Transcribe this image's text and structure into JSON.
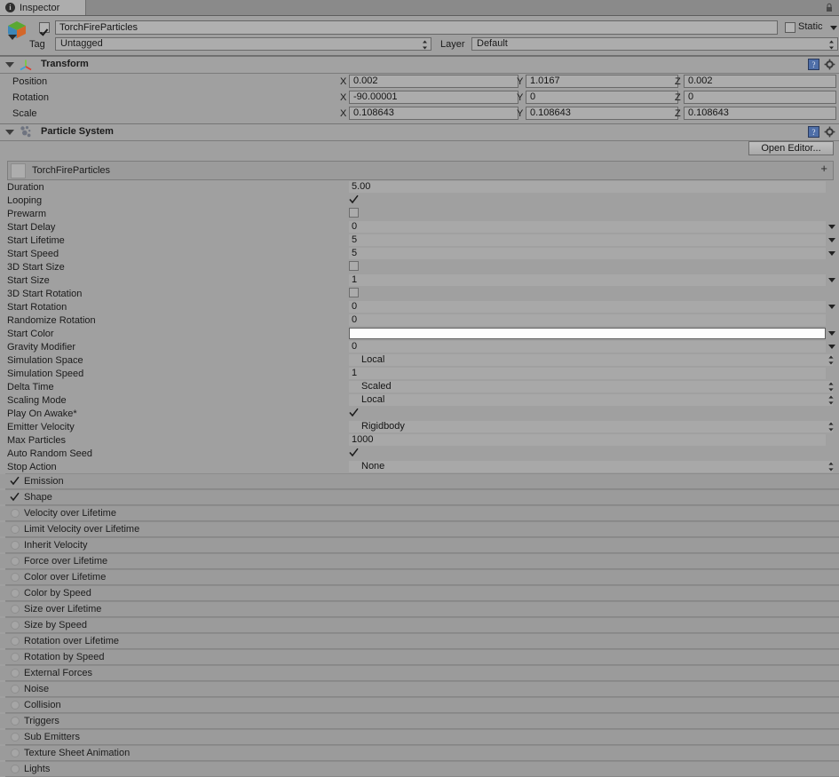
{
  "window": {
    "tab_label": "Inspector",
    "tab_icon": "info-icon",
    "lock_icon": "lock-icon"
  },
  "gameobject": {
    "icon": "gameobject-cube-icon",
    "enabled": true,
    "name": "TorchFireParticles",
    "name_placeholder": "Name",
    "static_label": "Static",
    "static_checked": false,
    "tag_label": "Tag",
    "tag_value": "Untagged",
    "layer_label": "Layer",
    "layer_value": "Default"
  },
  "transform": {
    "title": "Transform",
    "icon": "transform-axis-icon",
    "help_icon": "help-book-icon",
    "gear_icon": "gear-icon",
    "expanded": true,
    "rows": [
      {
        "label": "Position",
        "x": "0.002",
        "y": "1.0167",
        "z": "0.002"
      },
      {
        "label": "Rotation",
        "x": "-90.00001",
        "y": "0",
        "z": "0"
      },
      {
        "label": "Scale",
        "x": "0.108643",
        "y": "0.108643",
        "z": "0.108643"
      }
    ],
    "axis_labels": [
      "X",
      "Y",
      "Z"
    ]
  },
  "particle_system": {
    "title": "Particle System",
    "icon": "particle-system-icon",
    "help_icon": "help-book-icon",
    "gear_icon": "gear-icon",
    "expanded": true,
    "open_editor_label": "Open Editor...",
    "subheader_name": "TorchFireParticles",
    "add_label": "+",
    "properties": [
      {
        "label": "Duration",
        "value": "5.00",
        "kind": "text",
        "arrow": "none"
      },
      {
        "label": "Looping",
        "value": "",
        "kind": "checkbox",
        "checked": true,
        "arrow": "none"
      },
      {
        "label": "Prewarm",
        "value": "",
        "kind": "checkbox",
        "checked": false,
        "arrow": "none"
      },
      {
        "label": "Start Delay",
        "value": "0",
        "kind": "text",
        "arrow": "caret"
      },
      {
        "label": "Start Lifetime",
        "value": "5",
        "kind": "text",
        "arrow": "caret"
      },
      {
        "label": "Start Speed",
        "value": "5",
        "kind": "text",
        "arrow": "caret"
      },
      {
        "label": "3D Start Size",
        "value": "",
        "kind": "checkbox",
        "checked": false,
        "arrow": "none"
      },
      {
        "label": "Start Size",
        "value": "1",
        "kind": "text",
        "arrow": "caret"
      },
      {
        "label": "3D Start Rotation",
        "value": "",
        "kind": "checkbox",
        "checked": false,
        "arrow": "none"
      },
      {
        "label": "Start Rotation",
        "value": "0",
        "kind": "text",
        "arrow": "caret"
      },
      {
        "label": "Randomize Rotation",
        "value": "0",
        "kind": "text",
        "arrow": "none"
      },
      {
        "label": "Start Color",
        "value": "",
        "kind": "color",
        "color": "#fdfdfd",
        "arrow": "caret"
      },
      {
        "label": "Gravity Modifier",
        "value": "0",
        "kind": "text",
        "arrow": "caret"
      },
      {
        "label": "Simulation Space",
        "value": "Local",
        "kind": "enum",
        "arrow": "updown"
      },
      {
        "label": "Simulation Speed",
        "value": "1",
        "kind": "text",
        "arrow": "none"
      },
      {
        "label": "Delta Time",
        "value": "Scaled",
        "kind": "enum",
        "arrow": "updown"
      },
      {
        "label": "Scaling Mode",
        "value": "Local",
        "kind": "enum",
        "arrow": "updown"
      },
      {
        "label": "Play On Awake*",
        "value": "",
        "kind": "checkbox",
        "checked": true,
        "arrow": "none"
      },
      {
        "label": "Emitter Velocity",
        "value": "Rigidbody",
        "kind": "enum",
        "arrow": "updown"
      },
      {
        "label": "Max Particles",
        "value": "1000",
        "kind": "text",
        "arrow": "none"
      },
      {
        "label": "Auto Random Seed",
        "value": "",
        "kind": "checkbox",
        "checked": true,
        "arrow": "none"
      },
      {
        "label": "Stop Action",
        "value": "None",
        "kind": "enum",
        "arrow": "updown"
      }
    ],
    "modules": [
      {
        "label": "Emission",
        "enabled": true
      },
      {
        "label": "Shape",
        "enabled": true
      },
      {
        "label": "Velocity over Lifetime",
        "enabled": false
      },
      {
        "label": "Limit Velocity over Lifetime",
        "enabled": false
      },
      {
        "label": "Inherit Velocity",
        "enabled": false
      },
      {
        "label": "Force over Lifetime",
        "enabled": false
      },
      {
        "label": "Color over Lifetime",
        "enabled": false
      },
      {
        "label": "Color by Speed",
        "enabled": false
      },
      {
        "label": "Size over Lifetime",
        "enabled": false
      },
      {
        "label": "Size by Speed",
        "enabled": false
      },
      {
        "label": "Rotation over Lifetime",
        "enabled": false
      },
      {
        "label": "Rotation by Speed",
        "enabled": false
      },
      {
        "label": "External Forces",
        "enabled": false
      },
      {
        "label": "Noise",
        "enabled": false
      },
      {
        "label": "Collision",
        "enabled": false
      },
      {
        "label": "Triggers",
        "enabled": false
      },
      {
        "label": "Sub Emitters",
        "enabled": false
      },
      {
        "label": "Texture Sheet Animation",
        "enabled": false
      },
      {
        "label": "Lights",
        "enabled": false
      }
    ]
  },
  "colors": {
    "background": "#999999",
    "panel": "#a0a0a0",
    "field": "#acacac",
    "module_row": "#9b9b9b",
    "tab_active": "#adadad"
  }
}
